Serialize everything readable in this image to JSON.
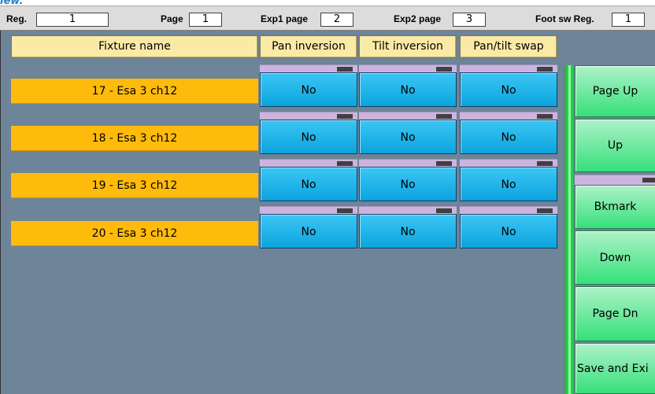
{
  "top_strip_text": "iew.",
  "status": {
    "reg_label": "Reg.",
    "reg_value": "1",
    "page_label": "Page",
    "page_value": "1",
    "exp1_label": "Exp1 page",
    "exp1_value": "2",
    "exp2_label": "Exp2 page",
    "exp2_value": "3",
    "footsw_label": "Foot sw Reg.",
    "footsw_value": "1"
  },
  "columns": {
    "fixture_name": "Fixture name",
    "pan_inversion": "Pan inversion",
    "tilt_inversion": "Tilt inversion",
    "pan_tilt_swap": "Pan/tilt swap"
  },
  "rows": [
    {
      "fixture": "17 - Esa 3 ch12",
      "pan": "No",
      "tilt": "No",
      "swap": "No"
    },
    {
      "fixture": "18 - Esa 3 ch12",
      "pan": "No",
      "tilt": "No",
      "swap": "No"
    },
    {
      "fixture": "19 - Esa 3 ch12",
      "pan": "No",
      "tilt": "No",
      "swap": "No"
    },
    {
      "fixture": "20 - Esa 3 ch12",
      "pan": "No",
      "tilt": "No",
      "swap": "No"
    }
  ],
  "nav": {
    "page_up": "Page Up",
    "up": "Up",
    "bookmark": "Bkmark",
    "down": "Down",
    "page_dn": "Page Dn",
    "save_exit": "Save and Exi"
  },
  "colors": {
    "panel_bg": "#6e8499",
    "header_bg": "#fbeaa6",
    "fixture_bg": "#ffbb0b",
    "cell_bg": "#1ab4ea",
    "nav_bg": "#5ee89a",
    "strip_bg": "#cdb4e0"
  }
}
